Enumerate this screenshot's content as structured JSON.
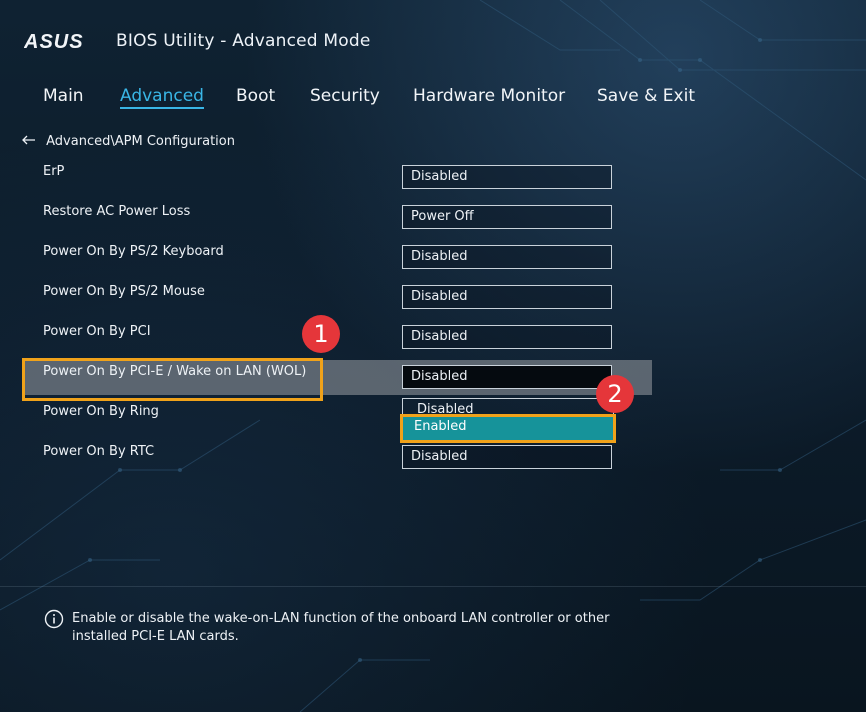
{
  "app": {
    "title": "BIOS Utility - Advanced Mode",
    "logo": "ASUS"
  },
  "tabs": [
    {
      "label": "Main"
    },
    {
      "label": "Advanced",
      "active": true
    },
    {
      "label": "Boot"
    },
    {
      "label": "Security"
    },
    {
      "label": "Hardware Monitor"
    },
    {
      "label": "Save & Exit"
    }
  ],
  "breadcrumb": "Advanced\\APM Configuration",
  "settings": [
    {
      "label": "ErP",
      "value": "Disabled"
    },
    {
      "label": "Restore AC Power Loss",
      "value": "Power Off"
    },
    {
      "label": "Power On By PS/2 Keyboard",
      "value": "Disabled"
    },
    {
      "label": "Power On By PS/2 Mouse",
      "value": "Disabled"
    },
    {
      "label": "Power On By PCI",
      "value": "Disabled"
    },
    {
      "label": "Power On By PCI-E / Wake on LAN (WOL)",
      "value": "Disabled"
    },
    {
      "label": "Power On By Ring",
      "value": ""
    },
    {
      "label": "Power On By RTC",
      "value": "Disabled"
    }
  ],
  "dropdown": {
    "options": [
      "Disabled",
      "Enabled"
    ],
    "highlighted": "Enabled"
  },
  "markers": [
    "1",
    "2"
  ],
  "help": {
    "icon": "info-icon",
    "text": "Enable or disable the wake-on-LAN function of the onboard LAN controller or other installed PCI-E LAN cards."
  },
  "colors": {
    "accent": "#39b6e6",
    "annotation": "#f0a21a",
    "marker": "#e5363a",
    "selected_option": "#16939a"
  }
}
